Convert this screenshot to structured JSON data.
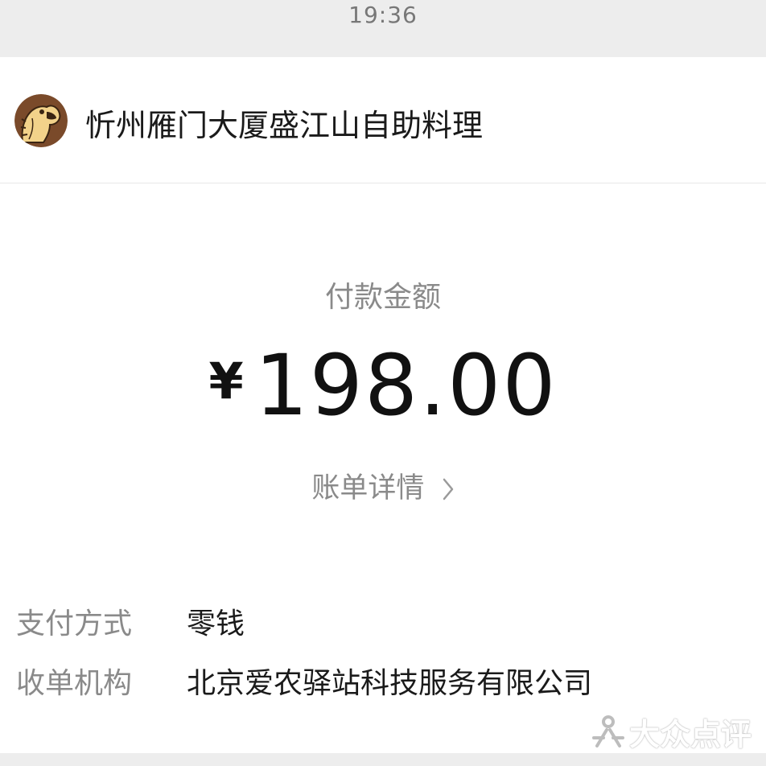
{
  "status_bar": {
    "time": "19:36"
  },
  "merchant": {
    "name": "忻州雁门大厦盛江山自助料理",
    "avatar_icon": "dinosaur-mascot-icon"
  },
  "payment": {
    "amount_label": "付款金额",
    "currency_symbol": "¥",
    "amount": "198.00",
    "bill_details_link": "账单详情"
  },
  "details": [
    {
      "label": "支付方式",
      "value": "零钱"
    },
    {
      "label": "收单机构",
      "value": "北京爱农驿站科技服务有限公司"
    }
  ],
  "watermark": {
    "text": "大众点评",
    "icon": "dianping-logo-icon"
  },
  "colors": {
    "status_bar_bg": "#ededed",
    "primary_text": "#1a1a1a",
    "secondary_text": "#8a8a8a",
    "avatar_bg": "#7a4a2a",
    "avatar_mascot": "#f2d28a"
  }
}
